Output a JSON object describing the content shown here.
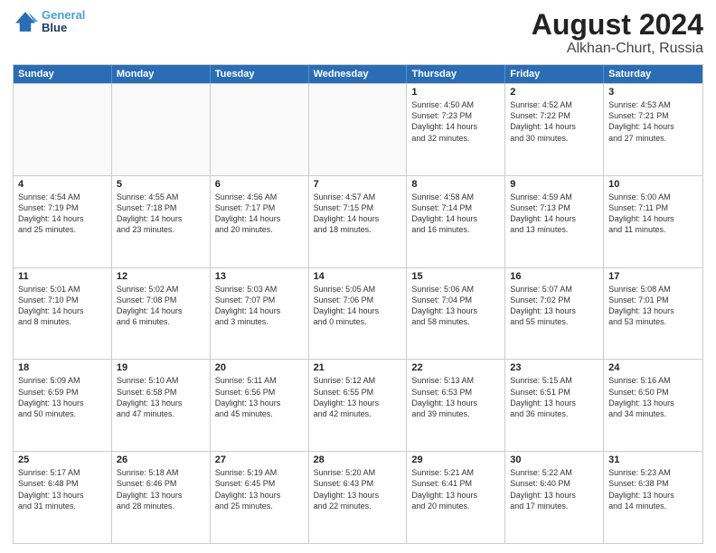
{
  "logo": {
    "line1": "General",
    "line2": "Blue"
  },
  "title": "August 2024",
  "subtitle": "Alkhan-Churt, Russia",
  "days": [
    "Sunday",
    "Monday",
    "Tuesday",
    "Wednesday",
    "Thursday",
    "Friday",
    "Saturday"
  ],
  "weeks": [
    [
      {
        "day": "",
        "empty": true
      },
      {
        "day": "",
        "empty": true
      },
      {
        "day": "",
        "empty": true
      },
      {
        "day": "",
        "empty": true
      },
      {
        "day": "1",
        "lines": [
          "Sunrise: 4:50 AM",
          "Sunset: 7:23 PM",
          "Daylight: 14 hours",
          "and 32 minutes."
        ]
      },
      {
        "day": "2",
        "lines": [
          "Sunrise: 4:52 AM",
          "Sunset: 7:22 PM",
          "Daylight: 14 hours",
          "and 30 minutes."
        ]
      },
      {
        "day": "3",
        "lines": [
          "Sunrise: 4:53 AM",
          "Sunset: 7:21 PM",
          "Daylight: 14 hours",
          "and 27 minutes."
        ]
      }
    ],
    [
      {
        "day": "4",
        "lines": [
          "Sunrise: 4:54 AM",
          "Sunset: 7:19 PM",
          "Daylight: 14 hours",
          "and 25 minutes."
        ]
      },
      {
        "day": "5",
        "lines": [
          "Sunrise: 4:55 AM",
          "Sunset: 7:18 PM",
          "Daylight: 14 hours",
          "and 23 minutes."
        ]
      },
      {
        "day": "6",
        "lines": [
          "Sunrise: 4:56 AM",
          "Sunset: 7:17 PM",
          "Daylight: 14 hours",
          "and 20 minutes."
        ]
      },
      {
        "day": "7",
        "lines": [
          "Sunrise: 4:57 AM",
          "Sunset: 7:15 PM",
          "Daylight: 14 hours",
          "and 18 minutes."
        ]
      },
      {
        "day": "8",
        "lines": [
          "Sunrise: 4:58 AM",
          "Sunset: 7:14 PM",
          "Daylight: 14 hours",
          "and 16 minutes."
        ]
      },
      {
        "day": "9",
        "lines": [
          "Sunrise: 4:59 AM",
          "Sunset: 7:13 PM",
          "Daylight: 14 hours",
          "and 13 minutes."
        ]
      },
      {
        "day": "10",
        "lines": [
          "Sunrise: 5:00 AM",
          "Sunset: 7:11 PM",
          "Daylight: 14 hours",
          "and 11 minutes."
        ]
      }
    ],
    [
      {
        "day": "11",
        "lines": [
          "Sunrise: 5:01 AM",
          "Sunset: 7:10 PM",
          "Daylight: 14 hours",
          "and 8 minutes."
        ]
      },
      {
        "day": "12",
        "lines": [
          "Sunrise: 5:02 AM",
          "Sunset: 7:08 PM",
          "Daylight: 14 hours",
          "and 6 minutes."
        ]
      },
      {
        "day": "13",
        "lines": [
          "Sunrise: 5:03 AM",
          "Sunset: 7:07 PM",
          "Daylight: 14 hours",
          "and 3 minutes."
        ]
      },
      {
        "day": "14",
        "lines": [
          "Sunrise: 5:05 AM",
          "Sunset: 7:06 PM",
          "Daylight: 14 hours",
          "and 0 minutes."
        ]
      },
      {
        "day": "15",
        "lines": [
          "Sunrise: 5:06 AM",
          "Sunset: 7:04 PM",
          "Daylight: 13 hours",
          "and 58 minutes."
        ]
      },
      {
        "day": "16",
        "lines": [
          "Sunrise: 5:07 AM",
          "Sunset: 7:02 PM",
          "Daylight: 13 hours",
          "and 55 minutes."
        ]
      },
      {
        "day": "17",
        "lines": [
          "Sunrise: 5:08 AM",
          "Sunset: 7:01 PM",
          "Daylight: 13 hours",
          "and 53 minutes."
        ]
      }
    ],
    [
      {
        "day": "18",
        "lines": [
          "Sunrise: 5:09 AM",
          "Sunset: 6:59 PM",
          "Daylight: 13 hours",
          "and 50 minutes."
        ]
      },
      {
        "day": "19",
        "lines": [
          "Sunrise: 5:10 AM",
          "Sunset: 6:58 PM",
          "Daylight: 13 hours",
          "and 47 minutes."
        ]
      },
      {
        "day": "20",
        "lines": [
          "Sunrise: 5:11 AM",
          "Sunset: 6:56 PM",
          "Daylight: 13 hours",
          "and 45 minutes."
        ]
      },
      {
        "day": "21",
        "lines": [
          "Sunrise: 5:12 AM",
          "Sunset: 6:55 PM",
          "Daylight: 13 hours",
          "and 42 minutes."
        ]
      },
      {
        "day": "22",
        "lines": [
          "Sunrise: 5:13 AM",
          "Sunset: 6:53 PM",
          "Daylight: 13 hours",
          "and 39 minutes."
        ]
      },
      {
        "day": "23",
        "lines": [
          "Sunrise: 5:15 AM",
          "Sunset: 6:51 PM",
          "Daylight: 13 hours",
          "and 36 minutes."
        ]
      },
      {
        "day": "24",
        "lines": [
          "Sunrise: 5:16 AM",
          "Sunset: 6:50 PM",
          "Daylight: 13 hours",
          "and 34 minutes."
        ]
      }
    ],
    [
      {
        "day": "25",
        "lines": [
          "Sunrise: 5:17 AM",
          "Sunset: 6:48 PM",
          "Daylight: 13 hours",
          "and 31 minutes."
        ]
      },
      {
        "day": "26",
        "lines": [
          "Sunrise: 5:18 AM",
          "Sunset: 6:46 PM",
          "Daylight: 13 hours",
          "and 28 minutes."
        ]
      },
      {
        "day": "27",
        "lines": [
          "Sunrise: 5:19 AM",
          "Sunset: 6:45 PM",
          "Daylight: 13 hours",
          "and 25 minutes."
        ]
      },
      {
        "day": "28",
        "lines": [
          "Sunrise: 5:20 AM",
          "Sunset: 6:43 PM",
          "Daylight: 13 hours",
          "and 22 minutes."
        ]
      },
      {
        "day": "29",
        "lines": [
          "Sunrise: 5:21 AM",
          "Sunset: 6:41 PM",
          "Daylight: 13 hours",
          "and 20 minutes."
        ]
      },
      {
        "day": "30",
        "lines": [
          "Sunrise: 5:22 AM",
          "Sunset: 6:40 PM",
          "Daylight: 13 hours",
          "and 17 minutes."
        ]
      },
      {
        "day": "31",
        "lines": [
          "Sunrise: 5:23 AM",
          "Sunset: 6:38 PM",
          "Daylight: 13 hours",
          "and 14 minutes."
        ]
      }
    ]
  ]
}
